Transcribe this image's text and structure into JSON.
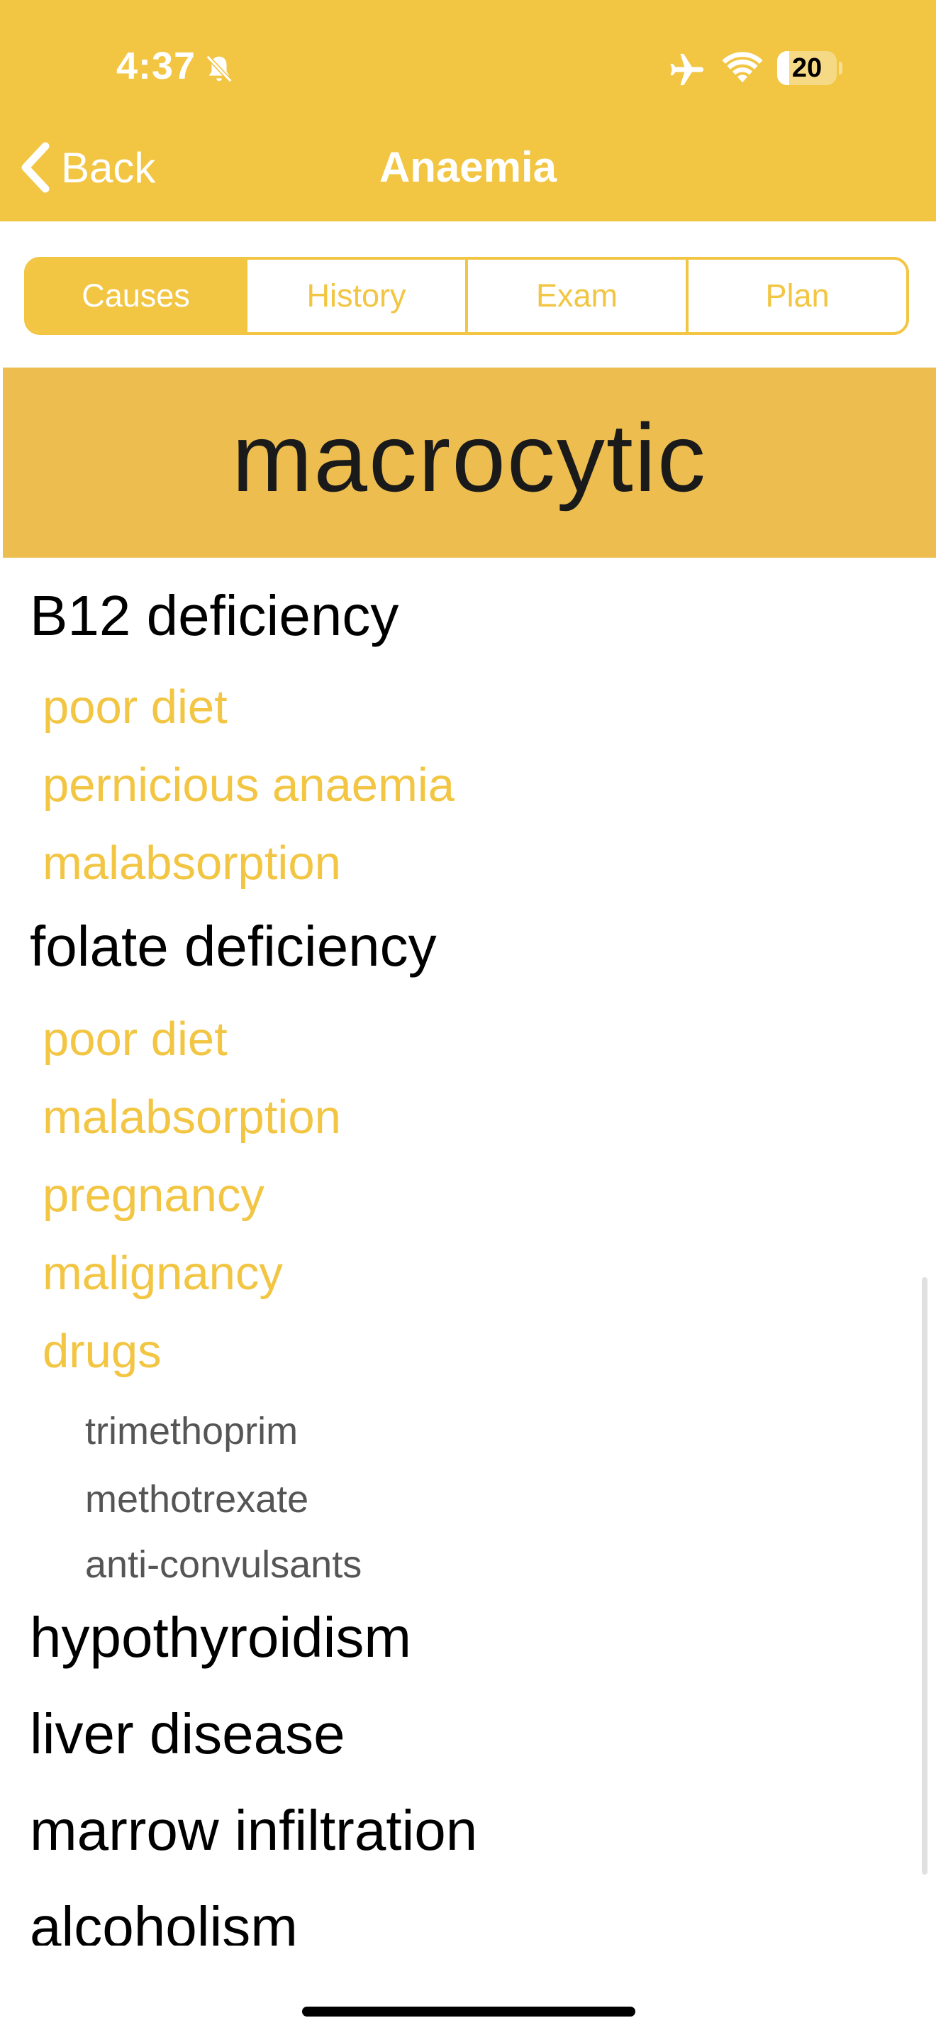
{
  "status_bar": {
    "time": "4:37",
    "battery_level": "20",
    "battery_fraction": 0.2,
    "icons": [
      "bell-slash-icon",
      "airplane-icon",
      "wifi-icon",
      "battery-icon"
    ]
  },
  "nav": {
    "back_label": "Back",
    "title": "Anaemia"
  },
  "tabs": [
    {
      "label": "Causes",
      "selected": true
    },
    {
      "label": "History",
      "selected": false
    },
    {
      "label": "Exam",
      "selected": false
    },
    {
      "label": "Plan",
      "selected": false
    }
  ],
  "section": {
    "title": "macrocytic"
  },
  "list": [
    {
      "level": 0,
      "text": "B12 deficiency"
    },
    {
      "level": 1,
      "text": "poor diet"
    },
    {
      "level": 1,
      "text": "pernicious anaemia"
    },
    {
      "level": 1,
      "text": "malabsorption"
    },
    {
      "level": 0,
      "text": "folate deficiency"
    },
    {
      "level": 1,
      "text": "poor diet"
    },
    {
      "level": 1,
      "text": "malabsorption"
    },
    {
      "level": 1,
      "text": "pregnancy"
    },
    {
      "level": 1,
      "text": "malignancy"
    },
    {
      "level": 1,
      "text": "drugs"
    },
    {
      "level": 2,
      "text": "trimethoprim"
    },
    {
      "level": 2,
      "text": "methotrexate"
    },
    {
      "level": 2,
      "text": "anti-convulsants"
    },
    {
      "level": 0,
      "text": "hypothyroidism"
    },
    {
      "level": 0,
      "text": "liver disease"
    },
    {
      "level": 0,
      "text": "marrow infiltration"
    },
    {
      "level": 0,
      "text": "alcoholism"
    }
  ],
  "colors": {
    "accent": "#F2C542",
    "banner": "#EDBE4F",
    "heading_text": "#000000",
    "subitem_text": "#F2C542",
    "detail_text": "#555555"
  }
}
